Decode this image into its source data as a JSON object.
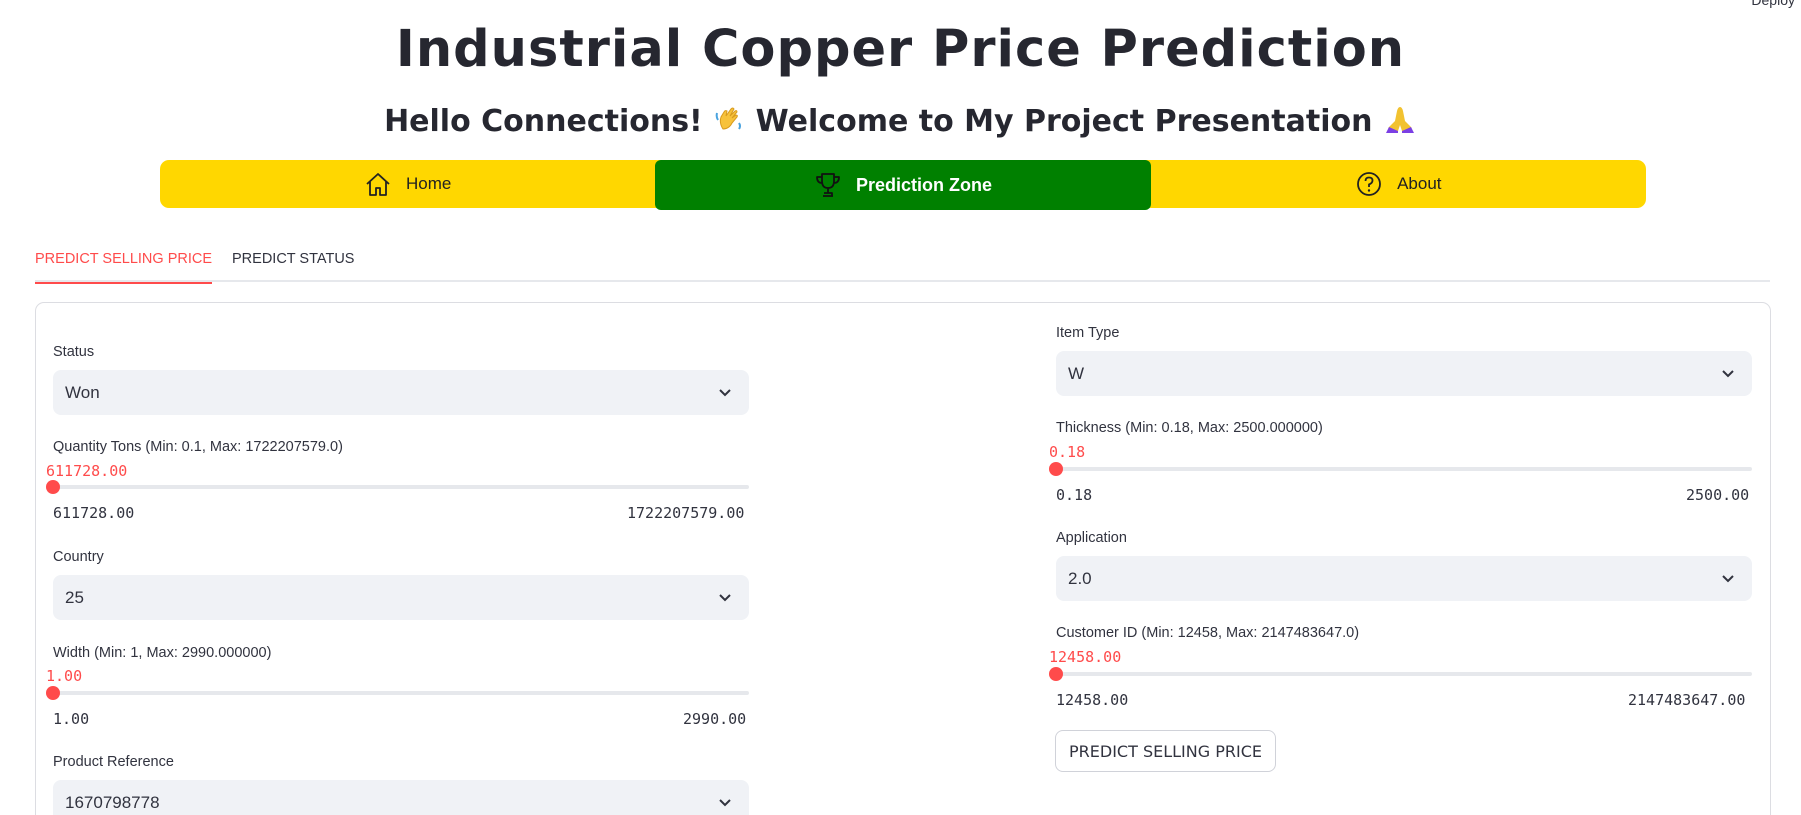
{
  "deploy_label": "Deploy",
  "title": "Industrial Copper Price Prediction",
  "subtitle_part1": "Hello Connections!",
  "subtitle_part2": "Welcome to My Project Presentation",
  "nav": {
    "home": "Home",
    "prediction": "Prediction Zone",
    "about": "About",
    "active_color": "#008000",
    "bar_color": "#ffd700"
  },
  "tabs": [
    "PREDICT SELLING PRICE",
    "PREDICT STATUS"
  ],
  "form": {
    "status": {
      "label": "Status",
      "value": "Won"
    },
    "quantity": {
      "label": "Quantity Tons (Min: 0.1, Max: 1722207579.0)",
      "value": "611728.00",
      "min": "611728.00",
      "max": "1722207579.00"
    },
    "country": {
      "label": "Country",
      "value": "25"
    },
    "width": {
      "label": "Width (Min: 1, Max: 2990.000000)",
      "value": "1.00",
      "min": "1.00",
      "max": "2990.00"
    },
    "product_ref": {
      "label": "Product Reference",
      "value": "1670798778"
    },
    "item_type": {
      "label": "Item Type",
      "value": "W"
    },
    "thickness": {
      "label": "Thickness (Min: 0.18, Max: 2500.000000)",
      "value": "0.18",
      "min": "0.18",
      "max": "2500.00"
    },
    "application": {
      "label": "Application",
      "value": "2.0"
    },
    "customer_id": {
      "label": "Customer ID (Min: 12458, Max: 2147483647.0)",
      "value": "12458.00",
      "min": "12458.00",
      "max": "2147483647.00"
    },
    "submit": "PREDICT SELLING PRICE"
  },
  "accent_color": "#ff4b4b"
}
